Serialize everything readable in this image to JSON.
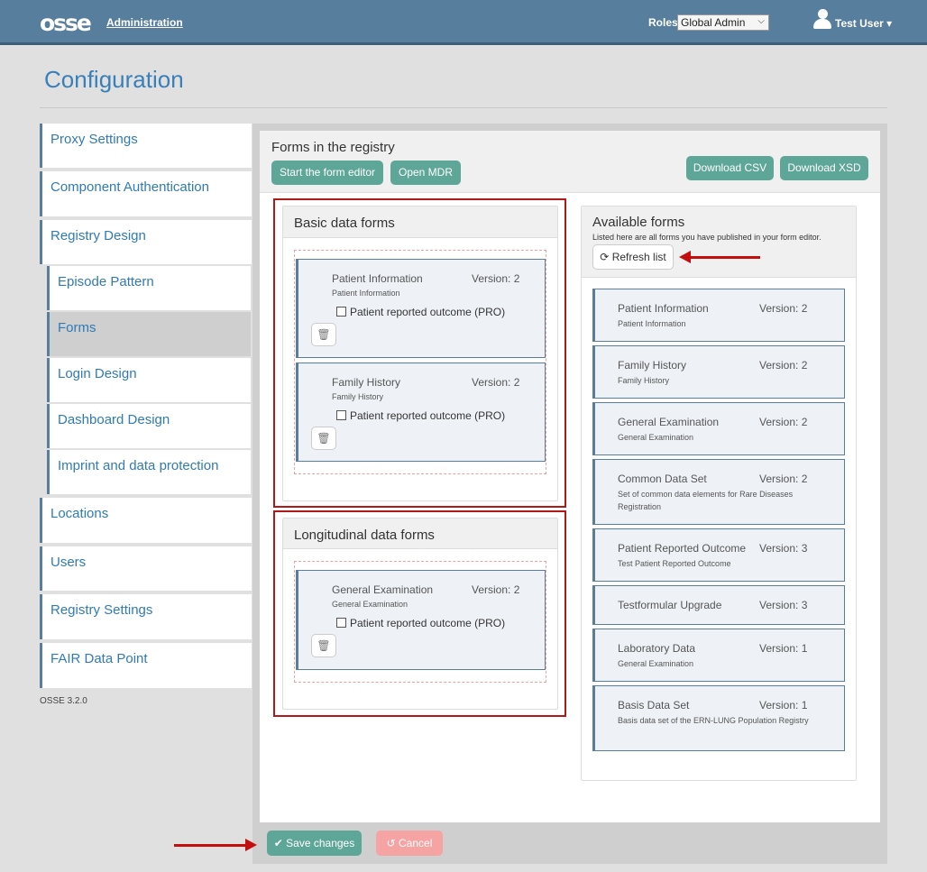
{
  "header": {
    "logo": "osse",
    "admin_link": "Administration",
    "roles_label": "Roles",
    "roles_selected": "Global Admin",
    "user_name": "Test User"
  },
  "page": {
    "title": "Configuration",
    "version": "OSSE 3.2.0"
  },
  "sidebar": {
    "items": [
      {
        "label": "Proxy Settings"
      },
      {
        "label": "Component Authentication"
      },
      {
        "label": "Registry Design"
      },
      {
        "label": "Episode Pattern"
      },
      {
        "label": "Forms"
      },
      {
        "label": "Login Design"
      },
      {
        "label": "Dashboard Design"
      },
      {
        "label": "Imprint and data protection"
      },
      {
        "label": "Locations"
      },
      {
        "label": "Users"
      },
      {
        "label": "Registry Settings"
      },
      {
        "label": "FAIR Data Point"
      }
    ]
  },
  "main": {
    "title": "Forms in the registry",
    "btn_form_editor": "Start the form editor",
    "btn_open_mdr": "Open MDR",
    "btn_download_csv": "Download CSV",
    "btn_download_xsd": "Download XSD"
  },
  "basic": {
    "title": "Basic data forms",
    "forms": [
      {
        "name": "Patient Information",
        "version": "Version: 2",
        "desc": "Patient Information",
        "check": "Patient reported outcome (PRO)"
      },
      {
        "name": "Family History",
        "version": "Version: 2",
        "desc": "Family History",
        "check": "Patient reported outcome (PRO)"
      }
    ]
  },
  "longitudinal": {
    "title": "Longitudinal data forms",
    "forms": [
      {
        "name": "General Examination",
        "version": "Version: 2",
        "desc": "General Examination",
        "check": "Patient reported outcome (PRO)"
      }
    ]
  },
  "available": {
    "title": "Available forms",
    "subtitle": "Listed here are all forms you have published in your form editor.",
    "refresh": "Refresh list",
    "forms": [
      {
        "name": "Patient Information",
        "version": "Version: 2",
        "desc": "Patient Information"
      },
      {
        "name": "Family History",
        "version": "Version: 2",
        "desc": "Family History"
      },
      {
        "name": "General Examination",
        "version": "Version: 2",
        "desc": "General Examination"
      },
      {
        "name": "Common Data Set",
        "version": "Version: 2",
        "desc": "Set of common data elements for Rare Diseases Registration"
      },
      {
        "name": "Patient Reported Outcome",
        "version": "Version: 3",
        "desc": "Test Patient Reported Outcome"
      },
      {
        "name": "Testformular Upgrade",
        "version": "Version: 3",
        "desc": ""
      },
      {
        "name": "Laboratory Data",
        "version": "Version: 1",
        "desc": "General Examination"
      },
      {
        "name": "Basis Data Set",
        "version": "Version: 1",
        "desc": "Basis data set of the ERN-LUNG Population Registry"
      }
    ]
  },
  "footer": {
    "save": "Save changes",
    "cancel": "Cancel"
  },
  "colors": {
    "header": "#587e9e",
    "accent": "#5ea698",
    "link": "#2f7bb5",
    "highlight": "#b01919",
    "cancel": "#f5a3a3"
  }
}
